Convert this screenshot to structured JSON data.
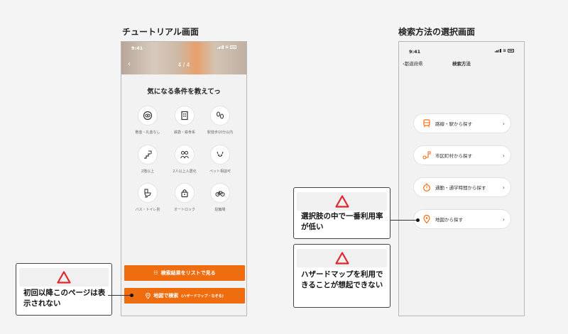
{
  "sections": {
    "tutorial_title": "チュートリアル画面",
    "search_method_title": "検索方法の選択画面"
  },
  "tutorial_screen": {
    "status_time": "9:41",
    "page_indicator": "4 / 4",
    "back_icon": "chevron-left-icon",
    "heading": "気になる条件を教えてっ",
    "conditions": [
      {
        "label": "敷金・礼金なし",
        "icon": "money-icon"
      },
      {
        "label": "鉄筋・鉄骨系",
        "icon": "building-icon"
      },
      {
        "label": "駅徒歩10分以内",
        "icon": "footprints-icon"
      },
      {
        "label": "2階以上",
        "icon": "stairs-icon"
      },
      {
        "label": "2人以上入居化",
        "icon": "people-icon"
      },
      {
        "label": "ペット相談可",
        "icon": "pet-icon"
      },
      {
        "label": "バス・トイレ別",
        "icon": "toilet-icon"
      },
      {
        "label": "オートロック",
        "icon": "lock-icon"
      },
      {
        "label": "駐輪場",
        "icon": "bicycle-icon"
      }
    ],
    "list_button": "検索結果をリストで見る",
    "map_button": "地図で検索",
    "map_button_sub": "(ハザードマップ・なぞる)",
    "accent_color": "#f06d0f"
  },
  "search_method_screen": {
    "status_time": "9:41",
    "back_label": "都道府県",
    "nav_title": "検索方法",
    "methods": [
      {
        "label": "路線・駅から探す",
        "icon": "train-icon"
      },
      {
        "label": "市区町村から探す",
        "icon": "area-icon"
      },
      {
        "label": "通勤・通学時間から探す",
        "icon": "timer-icon"
      },
      {
        "label": "地図から探す",
        "icon": "map-pin-icon"
      }
    ]
  },
  "annotations": {
    "tutorial_note": "初回以降このページは表示されない",
    "low_usage_note": "選択肢の中で一番利用率が低い",
    "hazard_note": "ハザードマップを利用できることが想起できない",
    "warning_icon": "warning-triangle-icon",
    "warning_color": "#e0262e"
  }
}
